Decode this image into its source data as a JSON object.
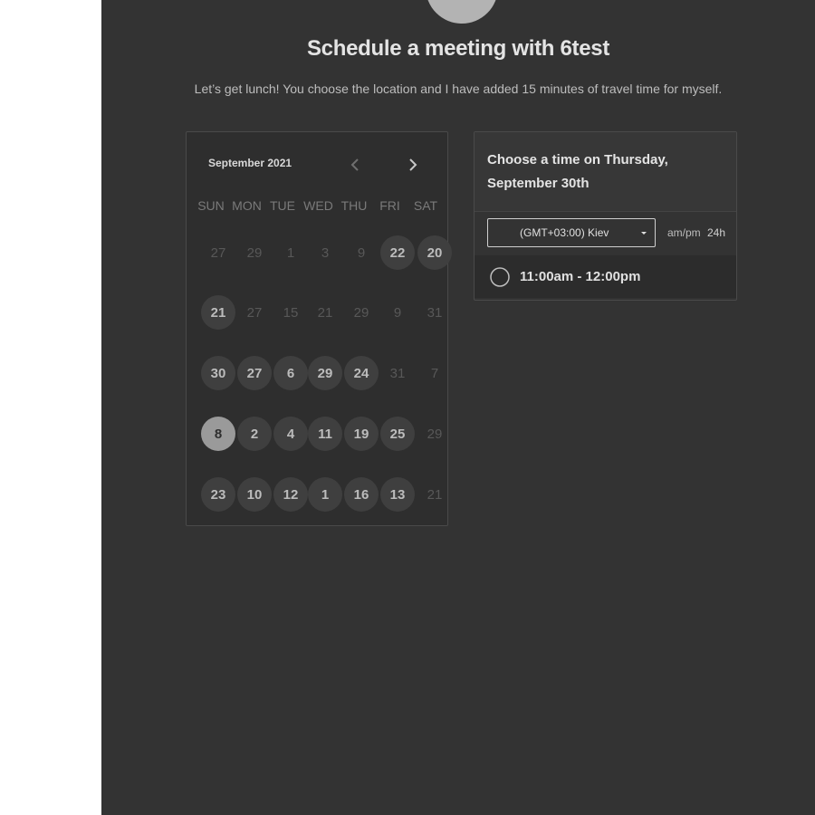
{
  "page": {
    "title": "Schedule a meeting with 6test",
    "description": "Let’s get lunch! You choose the location and I have added 15 minutes of travel time for myself."
  },
  "calendar": {
    "month_label": "September 2021",
    "prev_icon": "chevron-left-icon",
    "next_icon": "chevron-right-icon",
    "weekdays": [
      "SUN",
      "MON",
      "TUE",
      "WED",
      "THU",
      "FRI",
      "SAT"
    ],
    "weeks": [
      [
        {
          "d": "27",
          "s": "dim"
        },
        {
          "d": "29",
          "s": "dim"
        },
        {
          "d": "1",
          "s": "dim"
        },
        {
          "d": "3",
          "s": "dim"
        },
        {
          "d": "9",
          "s": "dim"
        },
        {
          "d": "22",
          "s": "avail"
        },
        {
          "d": "20",
          "s": "avail"
        }
      ],
      [
        {
          "d": "21",
          "s": "avail"
        },
        {
          "d": "27",
          "s": "dim"
        },
        {
          "d": "15",
          "s": "dim"
        },
        {
          "d": "21",
          "s": "dim"
        },
        {
          "d": "29",
          "s": "dim"
        },
        {
          "d": "9",
          "s": "dim"
        },
        {
          "d": "31",
          "s": "dim"
        }
      ],
      [
        {
          "d": "30",
          "s": "avail"
        },
        {
          "d": "27",
          "s": "avail"
        },
        {
          "d": "6",
          "s": "avail"
        },
        {
          "d": "29",
          "s": "avail"
        },
        {
          "d": "24",
          "s": "avail"
        },
        {
          "d": "31",
          "s": "dim"
        },
        {
          "d": "7",
          "s": "dim"
        }
      ],
      [
        {
          "d": "8",
          "s": "selected"
        },
        {
          "d": "2",
          "s": "avail"
        },
        {
          "d": "4",
          "s": "avail"
        },
        {
          "d": "11",
          "s": "avail"
        },
        {
          "d": "19",
          "s": "avail"
        },
        {
          "d": "25",
          "s": "avail"
        },
        {
          "d": "29",
          "s": "dim"
        }
      ],
      [
        {
          "d": "23",
          "s": "avail"
        },
        {
          "d": "10",
          "s": "avail"
        },
        {
          "d": "12",
          "s": "avail"
        },
        {
          "d": "1",
          "s": "avail"
        },
        {
          "d": "16",
          "s": "avail"
        },
        {
          "d": "13",
          "s": "avail"
        },
        {
          "d": "21",
          "s": "dim"
        }
      ]
    ]
  },
  "time_panel": {
    "heading": "Choose a time on Thursday, September 30th",
    "timezone": "(GMT+03:00) Kiev",
    "format_ampm": "am/pm",
    "format_24h": "24h",
    "slots": [
      "11:00am - 12:00pm"
    ]
  },
  "colors": {
    "panel_bg": "#333333",
    "available_day": "#3f3f3f",
    "selected_day": "#9a9a9a"
  }
}
